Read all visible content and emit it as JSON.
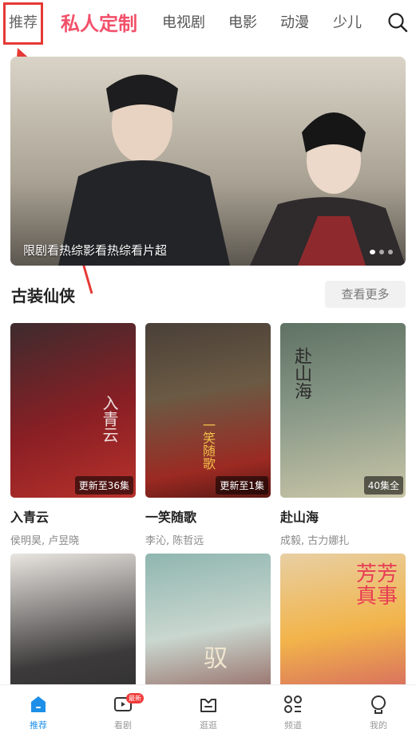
{
  "tabs": {
    "recommend": "推荐",
    "custom": "私人定制",
    "tv": "电视剧",
    "movie": "电影",
    "anime": "动漫",
    "kids": "少儿"
  },
  "banner": {
    "caption": "限剧看热综影看热综看片超",
    "dots": 3,
    "active_dot": 1
  },
  "section": {
    "title": "古装仙侠",
    "more": "查看更多"
  },
  "cards": [
    {
      "title": "入青云",
      "cast": "侯明昊, 卢昱晓",
      "badge": "更新至36集",
      "art_text": "入青云"
    },
    {
      "title": "一笑随歌",
      "cast": "李沁, 陈哲远",
      "badge": "更新至1集",
      "art_text": "一笑随歌"
    },
    {
      "title": "赴山海",
      "cast": "成毅, 古力娜扎",
      "badge": "40集全",
      "art_text": "赴山海"
    },
    {
      "title": "",
      "cast": "",
      "badge": "",
      "art_text": ""
    },
    {
      "title": "",
      "cast": "",
      "badge": "",
      "art_text": "驭"
    },
    {
      "title": "",
      "cast": "",
      "badge": "",
      "art_text": "芳芳真事"
    }
  ],
  "bottom_nav": [
    {
      "label": "推荐",
      "icon": "home-icon",
      "active": true
    },
    {
      "label": "看剧",
      "icon": "play-tv-icon",
      "badge": "最新"
    },
    {
      "label": "逛逛",
      "icon": "basket-icon"
    },
    {
      "label": "频道",
      "icon": "grid-channels-icon"
    },
    {
      "label": "我的",
      "icon": "profile-icon"
    }
  ],
  "colors": {
    "accent_pink": "#f2506a",
    "active_blue": "#1e8fe8",
    "annotation_red": "#e53935"
  }
}
